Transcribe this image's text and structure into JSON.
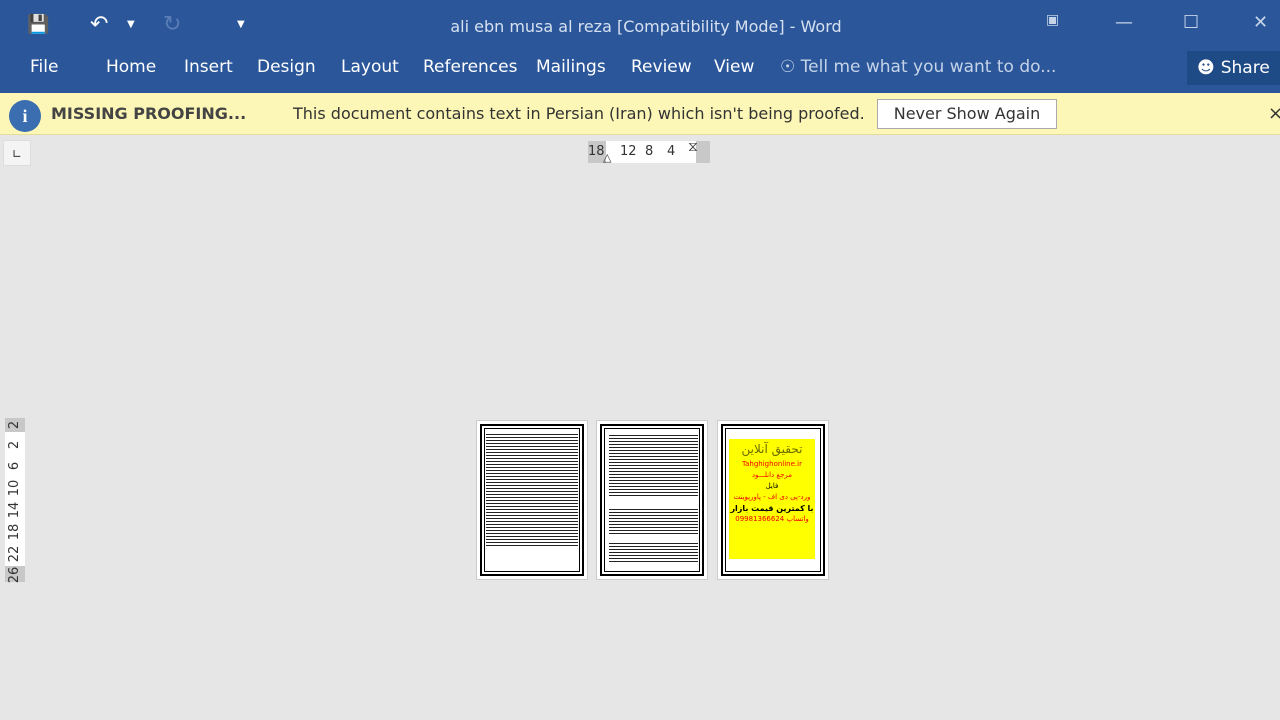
{
  "window": {
    "title": "ali ebn musa al reza [Compatibility Mode] - Word"
  },
  "qat": {
    "save": "save-icon",
    "undo": "undo-icon",
    "redo": "redo-icon",
    "customize": "customize-icon"
  },
  "ribbon": {
    "tabs": [
      "File",
      "Home",
      "Insert",
      "Design",
      "Layout",
      "References",
      "Mailings",
      "Review",
      "View"
    ],
    "tell_me": "Tell me what you want to do...",
    "share": "Share"
  },
  "message_bar": {
    "title": "MISSING PROOFING...",
    "text": "This document contains text in Persian (Iran) which isn't being proofed.",
    "button": "Never Show Again",
    "close": "×"
  },
  "ruler": {
    "horizontal": [
      "18",
      "12",
      "8",
      "4"
    ],
    "vertical": [
      "2",
      "2",
      "6",
      "10",
      "14",
      "18",
      "22",
      "26"
    ]
  },
  "pages": {
    "ad": {
      "title": "تحقیق آنلاین",
      "site": "Tahghighonline.ir",
      "l1": "مرجع دانلـــود",
      "l2": "فایل",
      "l3": "ورد-پی دی اف - پاورپوینت",
      "l4": "با کمترین قیمت بازار",
      "phone": "09981366624",
      "l5": "واتساپ"
    }
  }
}
